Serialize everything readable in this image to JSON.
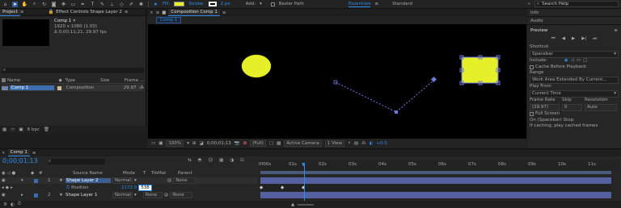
{
  "toolbar": {
    "fill_label": "Fill:",
    "fill_color": "#e5f029",
    "stroke_label": "Stroke:",
    "stroke_size": "2 px",
    "add_label": "Add:",
    "bezier_label": "Bezier Path",
    "workspace_active": "Essentials",
    "workspace_other": "Standard",
    "search_placeholder": "Search Help"
  },
  "project": {
    "tab_project": "Project",
    "tab_effect": "Effect Controls Shape Layer 2",
    "comp_name": "Comp 1",
    "comp_info_1": "1920 x 1080 (1.00)",
    "comp_info_2": "Δ 0;00;11;21, 29.97 fps",
    "search_icon_glyph": "⌕",
    "col_name": "Name",
    "col_type": "Type",
    "col_size": "Size",
    "col_frame": "Frame ...",
    "item_name": "Comp 1",
    "item_type": "Composition",
    "item_fps": "29.97",
    "bpc": "8 bpc"
  },
  "composition": {
    "tab_label": "Composition Comp 1",
    "sub_tab": "Comp 1",
    "zoom": "100%",
    "timecode": "0;00;01;13",
    "resolution": "(Full)",
    "camera": "Active Camera",
    "view": "1 View",
    "exposure": "+0.0",
    "shape_color": "#e5f029",
    "path_color": "#6f78d8"
  },
  "right_panel": {
    "info": "Info",
    "audio": "Audio",
    "preview": "Preview",
    "shortcut_label": "Shortcut",
    "shortcut_value": "Spacebar",
    "include_label": "Include:",
    "cache_label": "Cache Before Playback",
    "range_label": "Range",
    "range_value": "Work Area Extended By Current...",
    "play_from_label": "Play From",
    "play_from_value": "Current Time",
    "frame_rate_label": "Frame Rate",
    "skip_label": "Skip",
    "resolution_label": "Resolution",
    "frame_rate_value": "(29.97)",
    "skip_value": "0",
    "resolution_value": "Auto",
    "full_screen": "Full Screen",
    "on_stop": "On (Spacebar) Stop:",
    "on_stop_sub": "If caching, play cached frames"
  },
  "timeline": {
    "tab": "Comp 1",
    "timecode": "0;00;01;13",
    "col_source": "Source Name",
    "col_mode": "Mode",
    "col_trkmat": "TrkMat",
    "col_parent": "Parent",
    "ruler": [
      "0f00s",
      "01s",
      "02s",
      "03s",
      "04s",
      "05s",
      "06s",
      "07s",
      "08s",
      "09s",
      "10s",
      "11s"
    ],
    "layers": [
      {
        "num": "1",
        "name": "Shape Layer 2",
        "mode": "Normal",
        "trkmat": "",
        "parent": "None"
      },
      {
        "num": "2",
        "name": "Shape Layer 1",
        "mode": "Normal",
        "trkmat": "None",
        "parent": "None"
      }
    ],
    "property_name": "Position",
    "property_value_x": "1172.0",
    "property_value_y": "538"
  }
}
